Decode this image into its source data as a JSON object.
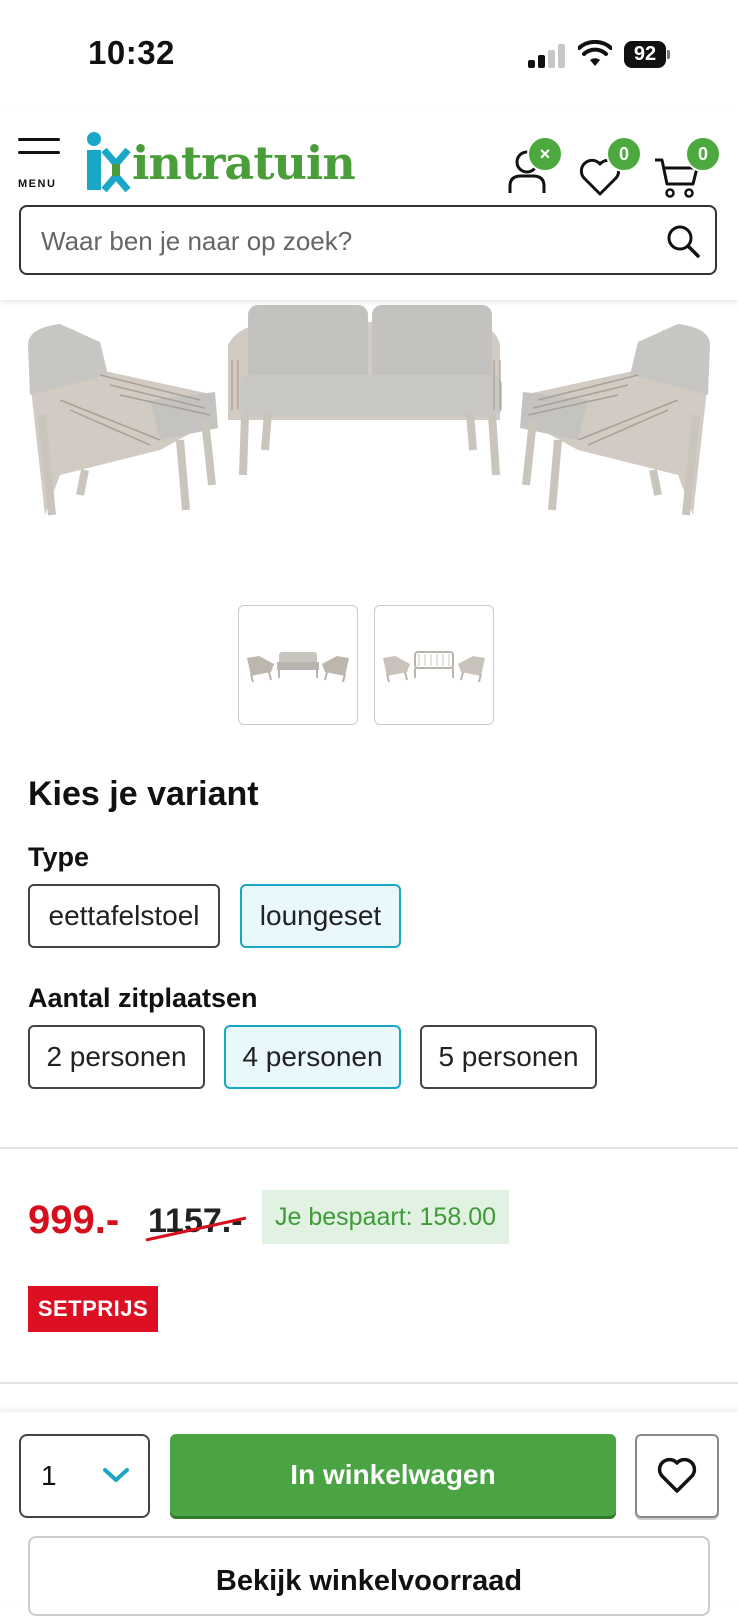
{
  "status_bar": {
    "time": "10:32",
    "battery": "92"
  },
  "header": {
    "menu_label": "MENU",
    "logo_text": "intratuin",
    "account_badge": "×",
    "wishlist_badge": "0",
    "cart_badge": "0",
    "search": {
      "placeholder": "Waar ben je naar op zoek?"
    },
    "colors": {
      "brand_green": "#4a9e3a",
      "brand_blue": "#1aa7c7"
    }
  },
  "gallery": {
    "icons": [
      "loungeset-photo-front",
      "loungeset-photo-side"
    ]
  },
  "variants": {
    "title": "Kies je variant",
    "groups": [
      {
        "label": "Type",
        "options": [
          "eettafelstoel",
          "loungeset"
        ],
        "selected": "loungeset"
      },
      {
        "label": "Aantal zitplaatsen",
        "options": [
          "2 personen",
          "4 personen",
          "5 personen"
        ],
        "selected": "4 personen"
      }
    ]
  },
  "pricing": {
    "price": "999.-",
    "old_price": "1157.-",
    "savings": "Je bespaart: 158.00",
    "label": "SETPRIJS",
    "colors": {
      "price_red": "#d50f1c",
      "savings_green": "#3e9b37"
    }
  },
  "actions": {
    "quantity": "1",
    "add_to_cart": "In winkelwagen",
    "stock": "Bekijk winkelvoorraad"
  }
}
